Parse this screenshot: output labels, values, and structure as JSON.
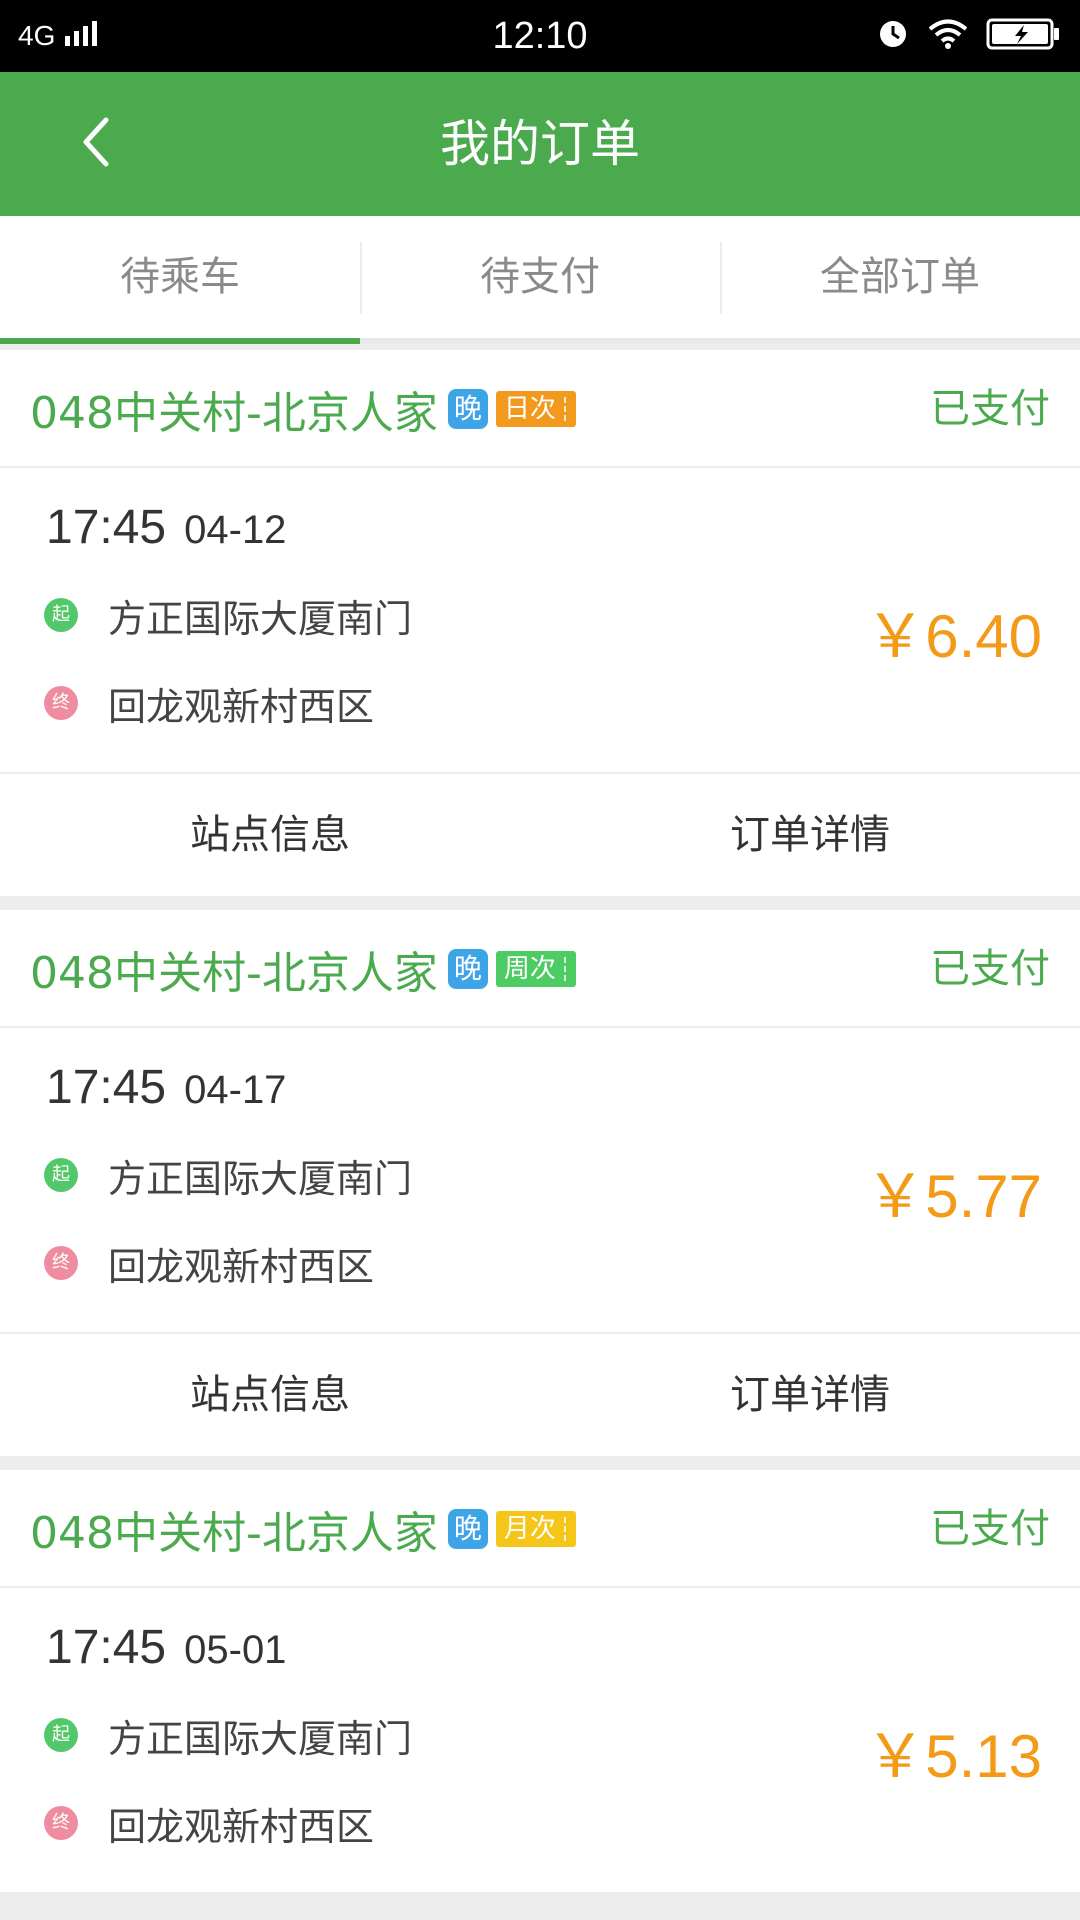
{
  "status_bar": {
    "network": "4G",
    "time": "12:10",
    "icons": [
      "signal-icon",
      "alarm-icon",
      "wifi-icon",
      "battery-charging-icon"
    ]
  },
  "header": {
    "back_icon": "chevron-left-icon",
    "title": "我的订单"
  },
  "tabs": [
    {
      "label": "待乘车",
      "active": true
    },
    {
      "label": "待支付",
      "active": false
    },
    {
      "label": "全部订单",
      "active": false
    }
  ],
  "orders": [
    {
      "route": "048中关村-北京人家",
      "time_tag": "晚",
      "ticket_tag": "日次",
      "ticket_tag_color": "#f29a1d",
      "status": "已支付",
      "depart_time": "17:45",
      "depart_date": "04-12",
      "start_badge": "起",
      "start_stop": "方正国际大厦南门",
      "end_badge": "终",
      "end_stop": "回龙观新村西区",
      "price": "￥6.40",
      "actions": [
        "站点信息",
        "订单详情"
      ]
    },
    {
      "route": "048中关村-北京人家",
      "time_tag": "晚",
      "ticket_tag": "周次",
      "ticket_tag_color": "#4dcc63",
      "status": "已支付",
      "depart_time": "17:45",
      "depart_date": "04-17",
      "start_badge": "起",
      "start_stop": "方正国际大厦南门",
      "end_badge": "终",
      "end_stop": "回龙观新村西区",
      "price": "￥5.77",
      "actions": [
        "站点信息",
        "订单详情"
      ]
    },
    {
      "route": "048中关村-北京人家",
      "time_tag": "晚",
      "ticket_tag": "月次",
      "ticket_tag_color": "#f5c51a",
      "status": "已支付",
      "depart_time": "17:45",
      "depart_date": "05-01",
      "start_badge": "起",
      "start_stop": "方正国际大厦南门",
      "end_badge": "终",
      "end_stop": "回龙观新村西区",
      "price": "￥5.13"
    }
  ],
  "colors": {
    "brand_green": "#4caa4e",
    "price_orange": "#f39a18",
    "tag_blue": "#3ea4e8"
  }
}
